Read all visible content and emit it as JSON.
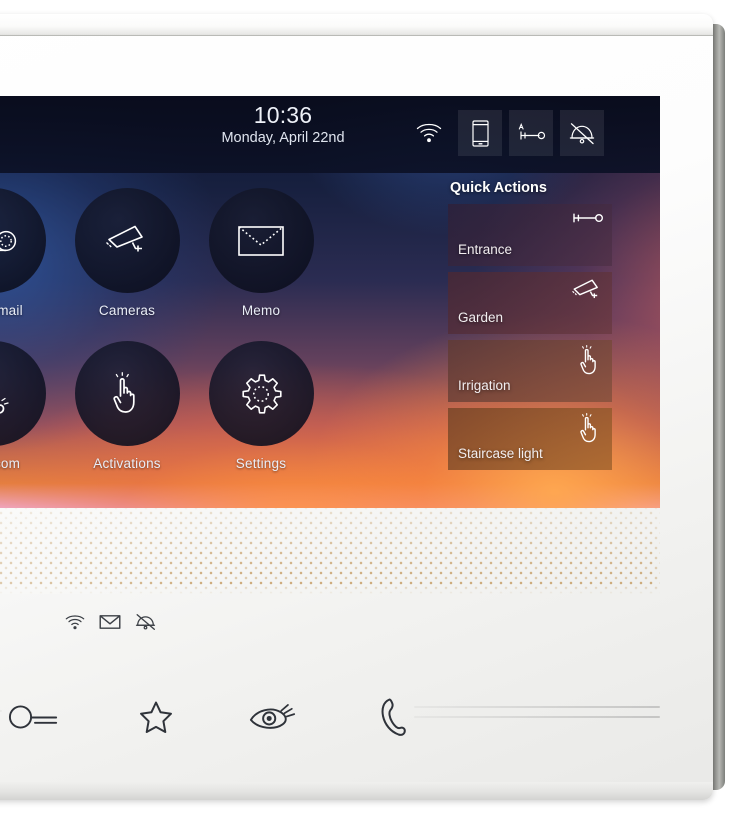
{
  "device": {
    "name": "indoor-video-door-station",
    "frame_color": "#f4f4f2",
    "edge_color": "#8e8f8b"
  },
  "screen": {
    "statusbar": {
      "time": "10:36",
      "date": "Monday, April 22nd",
      "icons": [
        {
          "name": "wifi-icon",
          "label": "Wi-Fi",
          "active": false
        },
        {
          "name": "smartphone-icon",
          "label": "Smartphone call forwarding",
          "active": true
        },
        {
          "name": "key-auto-icon",
          "label": "Automatic door opener",
          "active": false
        },
        {
          "name": "bell-muted-icon",
          "label": "Ringtone muted",
          "active": false
        }
      ]
    },
    "apps": [
      {
        "name": "voicemail",
        "label": "Voicemail",
        "icon": "voicemail-icon"
      },
      {
        "name": "cameras",
        "label": "Cameras",
        "icon": "cctv-camera-icon"
      },
      {
        "name": "memo",
        "label": "Memo",
        "icon": "envelope-icon"
      },
      {
        "name": "intercom",
        "label": "Intercom",
        "icon": "phone-handset-icon"
      },
      {
        "name": "activations",
        "label": "Activations",
        "icon": "tap-hand-icon"
      },
      {
        "name": "settings",
        "label": "Settings",
        "icon": "gear-icon"
      }
    ],
    "quick_actions": {
      "title": "Quick Actions",
      "tiles": [
        {
          "name": "entrance",
          "label": "Entrance",
          "icon": "key-icon",
          "color": "#3b2a42"
        },
        {
          "name": "garden",
          "label": "Garden",
          "icon": "cctv-camera-icon",
          "color": "#5c3340"
        },
        {
          "name": "irrigation",
          "label": "Irrigation",
          "icon": "tap-hand-icon",
          "color": "#6e4440"
        },
        {
          "name": "staircase-light",
          "label": "Staircase light",
          "icon": "tap-hand-icon",
          "color": "#8a5330"
        }
      ]
    },
    "wallpaper": {
      "top_color": "#101432",
      "mid_color": "#62405c",
      "bottom_color": "#e4803f"
    }
  },
  "hardware": {
    "notification_icons": [
      {
        "name": "wifi-status-icon",
        "label": "Wi-Fi connected"
      },
      {
        "name": "mail-status-icon",
        "label": "New message"
      },
      {
        "name": "bell-muted-status-icon",
        "label": "Ringtone off"
      }
    ],
    "touch_buttons": [
      {
        "name": "door-opener-button",
        "label": "Door opener",
        "icon": "key-icon"
      },
      {
        "name": "favorite-button",
        "label": "Favourite",
        "icon": "star-icon"
      },
      {
        "name": "self-start-button",
        "label": "Self-start / view",
        "icon": "eye-icon"
      },
      {
        "name": "call-button",
        "label": "Call / answer",
        "icon": "phone-handset-icon"
      }
    ],
    "grille": {
      "name": "speaker-grille",
      "dot_color": "#c9a470"
    }
  }
}
